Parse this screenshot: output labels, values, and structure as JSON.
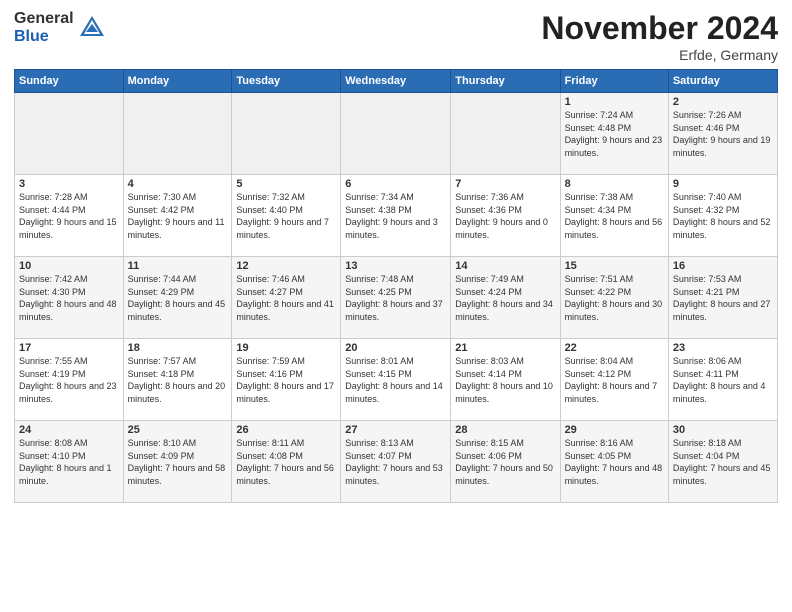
{
  "logo": {
    "general": "General",
    "blue": "Blue"
  },
  "title": "November 2024",
  "location": "Erfde, Germany",
  "days_header": [
    "Sunday",
    "Monday",
    "Tuesday",
    "Wednesday",
    "Thursday",
    "Friday",
    "Saturday"
  ],
  "weeks": [
    [
      {
        "day": "",
        "info": ""
      },
      {
        "day": "",
        "info": ""
      },
      {
        "day": "",
        "info": ""
      },
      {
        "day": "",
        "info": ""
      },
      {
        "day": "",
        "info": ""
      },
      {
        "day": "1",
        "info": "Sunrise: 7:24 AM\nSunset: 4:48 PM\nDaylight: 9 hours and 23 minutes."
      },
      {
        "day": "2",
        "info": "Sunrise: 7:26 AM\nSunset: 4:46 PM\nDaylight: 9 hours and 19 minutes."
      }
    ],
    [
      {
        "day": "3",
        "info": "Sunrise: 7:28 AM\nSunset: 4:44 PM\nDaylight: 9 hours and 15 minutes."
      },
      {
        "day": "4",
        "info": "Sunrise: 7:30 AM\nSunset: 4:42 PM\nDaylight: 9 hours and 11 minutes."
      },
      {
        "day": "5",
        "info": "Sunrise: 7:32 AM\nSunset: 4:40 PM\nDaylight: 9 hours and 7 minutes."
      },
      {
        "day": "6",
        "info": "Sunrise: 7:34 AM\nSunset: 4:38 PM\nDaylight: 9 hours and 3 minutes."
      },
      {
        "day": "7",
        "info": "Sunrise: 7:36 AM\nSunset: 4:36 PM\nDaylight: 9 hours and 0 minutes."
      },
      {
        "day": "8",
        "info": "Sunrise: 7:38 AM\nSunset: 4:34 PM\nDaylight: 8 hours and 56 minutes."
      },
      {
        "day": "9",
        "info": "Sunrise: 7:40 AM\nSunset: 4:32 PM\nDaylight: 8 hours and 52 minutes."
      }
    ],
    [
      {
        "day": "10",
        "info": "Sunrise: 7:42 AM\nSunset: 4:30 PM\nDaylight: 8 hours and 48 minutes."
      },
      {
        "day": "11",
        "info": "Sunrise: 7:44 AM\nSunset: 4:29 PM\nDaylight: 8 hours and 45 minutes."
      },
      {
        "day": "12",
        "info": "Sunrise: 7:46 AM\nSunset: 4:27 PM\nDaylight: 8 hours and 41 minutes."
      },
      {
        "day": "13",
        "info": "Sunrise: 7:48 AM\nSunset: 4:25 PM\nDaylight: 8 hours and 37 minutes."
      },
      {
        "day": "14",
        "info": "Sunrise: 7:49 AM\nSunset: 4:24 PM\nDaylight: 8 hours and 34 minutes."
      },
      {
        "day": "15",
        "info": "Sunrise: 7:51 AM\nSunset: 4:22 PM\nDaylight: 8 hours and 30 minutes."
      },
      {
        "day": "16",
        "info": "Sunrise: 7:53 AM\nSunset: 4:21 PM\nDaylight: 8 hours and 27 minutes."
      }
    ],
    [
      {
        "day": "17",
        "info": "Sunrise: 7:55 AM\nSunset: 4:19 PM\nDaylight: 8 hours and 23 minutes."
      },
      {
        "day": "18",
        "info": "Sunrise: 7:57 AM\nSunset: 4:18 PM\nDaylight: 8 hours and 20 minutes."
      },
      {
        "day": "19",
        "info": "Sunrise: 7:59 AM\nSunset: 4:16 PM\nDaylight: 8 hours and 17 minutes."
      },
      {
        "day": "20",
        "info": "Sunrise: 8:01 AM\nSunset: 4:15 PM\nDaylight: 8 hours and 14 minutes."
      },
      {
        "day": "21",
        "info": "Sunrise: 8:03 AM\nSunset: 4:14 PM\nDaylight: 8 hours and 10 minutes."
      },
      {
        "day": "22",
        "info": "Sunrise: 8:04 AM\nSunset: 4:12 PM\nDaylight: 8 hours and 7 minutes."
      },
      {
        "day": "23",
        "info": "Sunrise: 8:06 AM\nSunset: 4:11 PM\nDaylight: 8 hours and 4 minutes."
      }
    ],
    [
      {
        "day": "24",
        "info": "Sunrise: 8:08 AM\nSunset: 4:10 PM\nDaylight: 8 hours and 1 minute."
      },
      {
        "day": "25",
        "info": "Sunrise: 8:10 AM\nSunset: 4:09 PM\nDaylight: 7 hours and 58 minutes."
      },
      {
        "day": "26",
        "info": "Sunrise: 8:11 AM\nSunset: 4:08 PM\nDaylight: 7 hours and 56 minutes."
      },
      {
        "day": "27",
        "info": "Sunrise: 8:13 AM\nSunset: 4:07 PM\nDaylight: 7 hours and 53 minutes."
      },
      {
        "day": "28",
        "info": "Sunrise: 8:15 AM\nSunset: 4:06 PM\nDaylight: 7 hours and 50 minutes."
      },
      {
        "day": "29",
        "info": "Sunrise: 8:16 AM\nSunset: 4:05 PM\nDaylight: 7 hours and 48 minutes."
      },
      {
        "day": "30",
        "info": "Sunrise: 8:18 AM\nSunset: 4:04 PM\nDaylight: 7 hours and 45 minutes."
      }
    ]
  ]
}
